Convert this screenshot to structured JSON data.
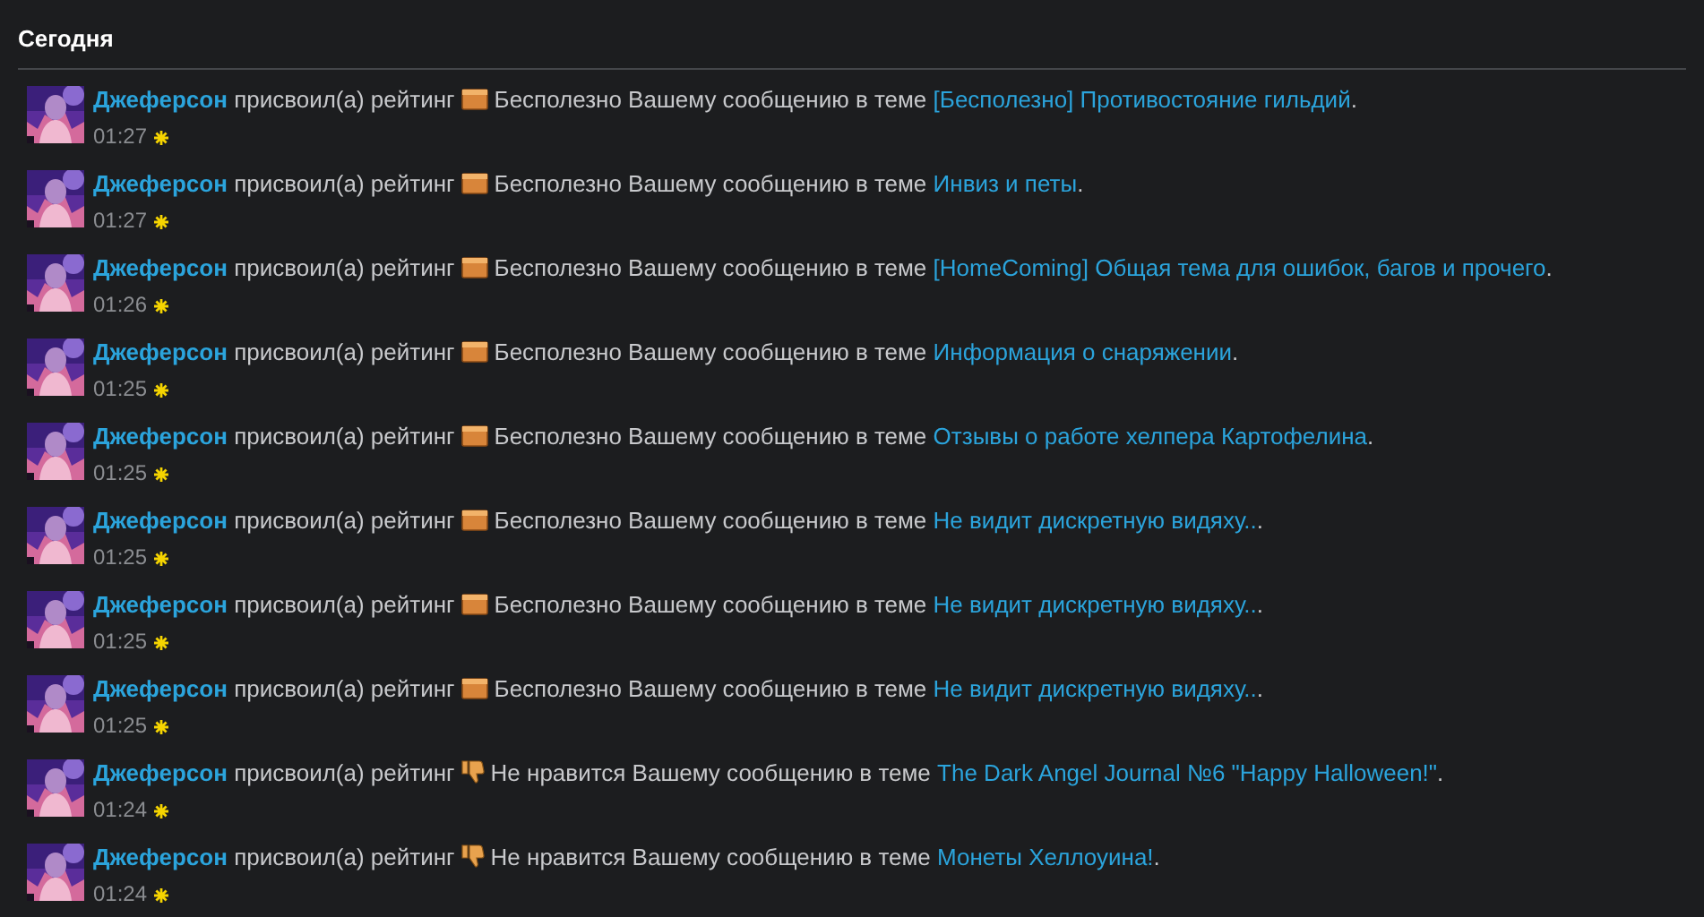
{
  "heading": "Сегодня",
  "alerts": [
    {
      "user": "Джеферсон",
      "action": "присвоил(а) рейтинг",
      "kind": "useless",
      "message": "Бесполезно Вашему сообщению в теме",
      "topic": "[Бесполезно] Противостояние гильдий",
      "suffix": ".",
      "time": "01:27"
    },
    {
      "user": "Джеферсон",
      "action": "присвоил(а) рейтинг",
      "kind": "useless",
      "message": "Бесполезно Вашему сообщению в теме",
      "topic": "Инвиз и петы",
      "suffix": ".",
      "time": "01:27"
    },
    {
      "user": "Джеферсон",
      "action": "присвоил(а) рейтинг",
      "kind": "useless",
      "message": "Бесполезно Вашему сообщению в теме",
      "topic": "[HomeComing] Общая тема для ошибок, багов и прочего",
      "suffix": ".",
      "time": "01:26"
    },
    {
      "user": "Джеферсон",
      "action": "присвоил(а) рейтинг",
      "kind": "useless",
      "message": "Бесполезно Вашему сообщению в теме",
      "topic": "Информация о снаряжении",
      "suffix": ".",
      "time": "01:25"
    },
    {
      "user": "Джеферсон",
      "action": "присвоил(а) рейтинг",
      "kind": "useless",
      "message": "Бесполезно Вашему сообщению в теме",
      "topic": "Отзывы о работе хелпера Картофелина",
      "suffix": ".",
      "time": "01:25"
    },
    {
      "user": "Джеферсон",
      "action": "присвоил(а) рейтинг",
      "kind": "useless",
      "message": "Бесполезно Вашему сообщению в теме",
      "topic": "Не видит дискретную видяху..",
      "suffix": ".",
      "time": "01:25"
    },
    {
      "user": "Джеферсон",
      "action": "присвоил(а) рейтинг",
      "kind": "useless",
      "message": "Бесполезно Вашему сообщению в теме",
      "topic": "Не видит дискретную видяху..",
      "suffix": ".",
      "time": "01:25"
    },
    {
      "user": "Джеферсон",
      "action": "присвоил(а) рейтинг",
      "kind": "useless",
      "message": "Бесполезно Вашему сообщению в теме",
      "topic": "Не видит дискретную видяху..",
      "suffix": ".",
      "time": "01:25"
    },
    {
      "user": "Джеферсон",
      "action": "присвоил(а) рейтинг",
      "kind": "dislike",
      "message": "Не нравится Вашему сообщению в теме",
      "topic": "The Dark Angel Journal №6 \"Happy Halloween!\"",
      "suffix": ".",
      "time": "01:24"
    },
    {
      "user": "Джеферсон",
      "action": "присвоил(а) рейтинг",
      "kind": "dislike",
      "message": "Не нравится Вашему сообщению в теме",
      "topic": "Монеты Хеллоуина!",
      "suffix": ".",
      "time": "01:24"
    }
  ]
}
